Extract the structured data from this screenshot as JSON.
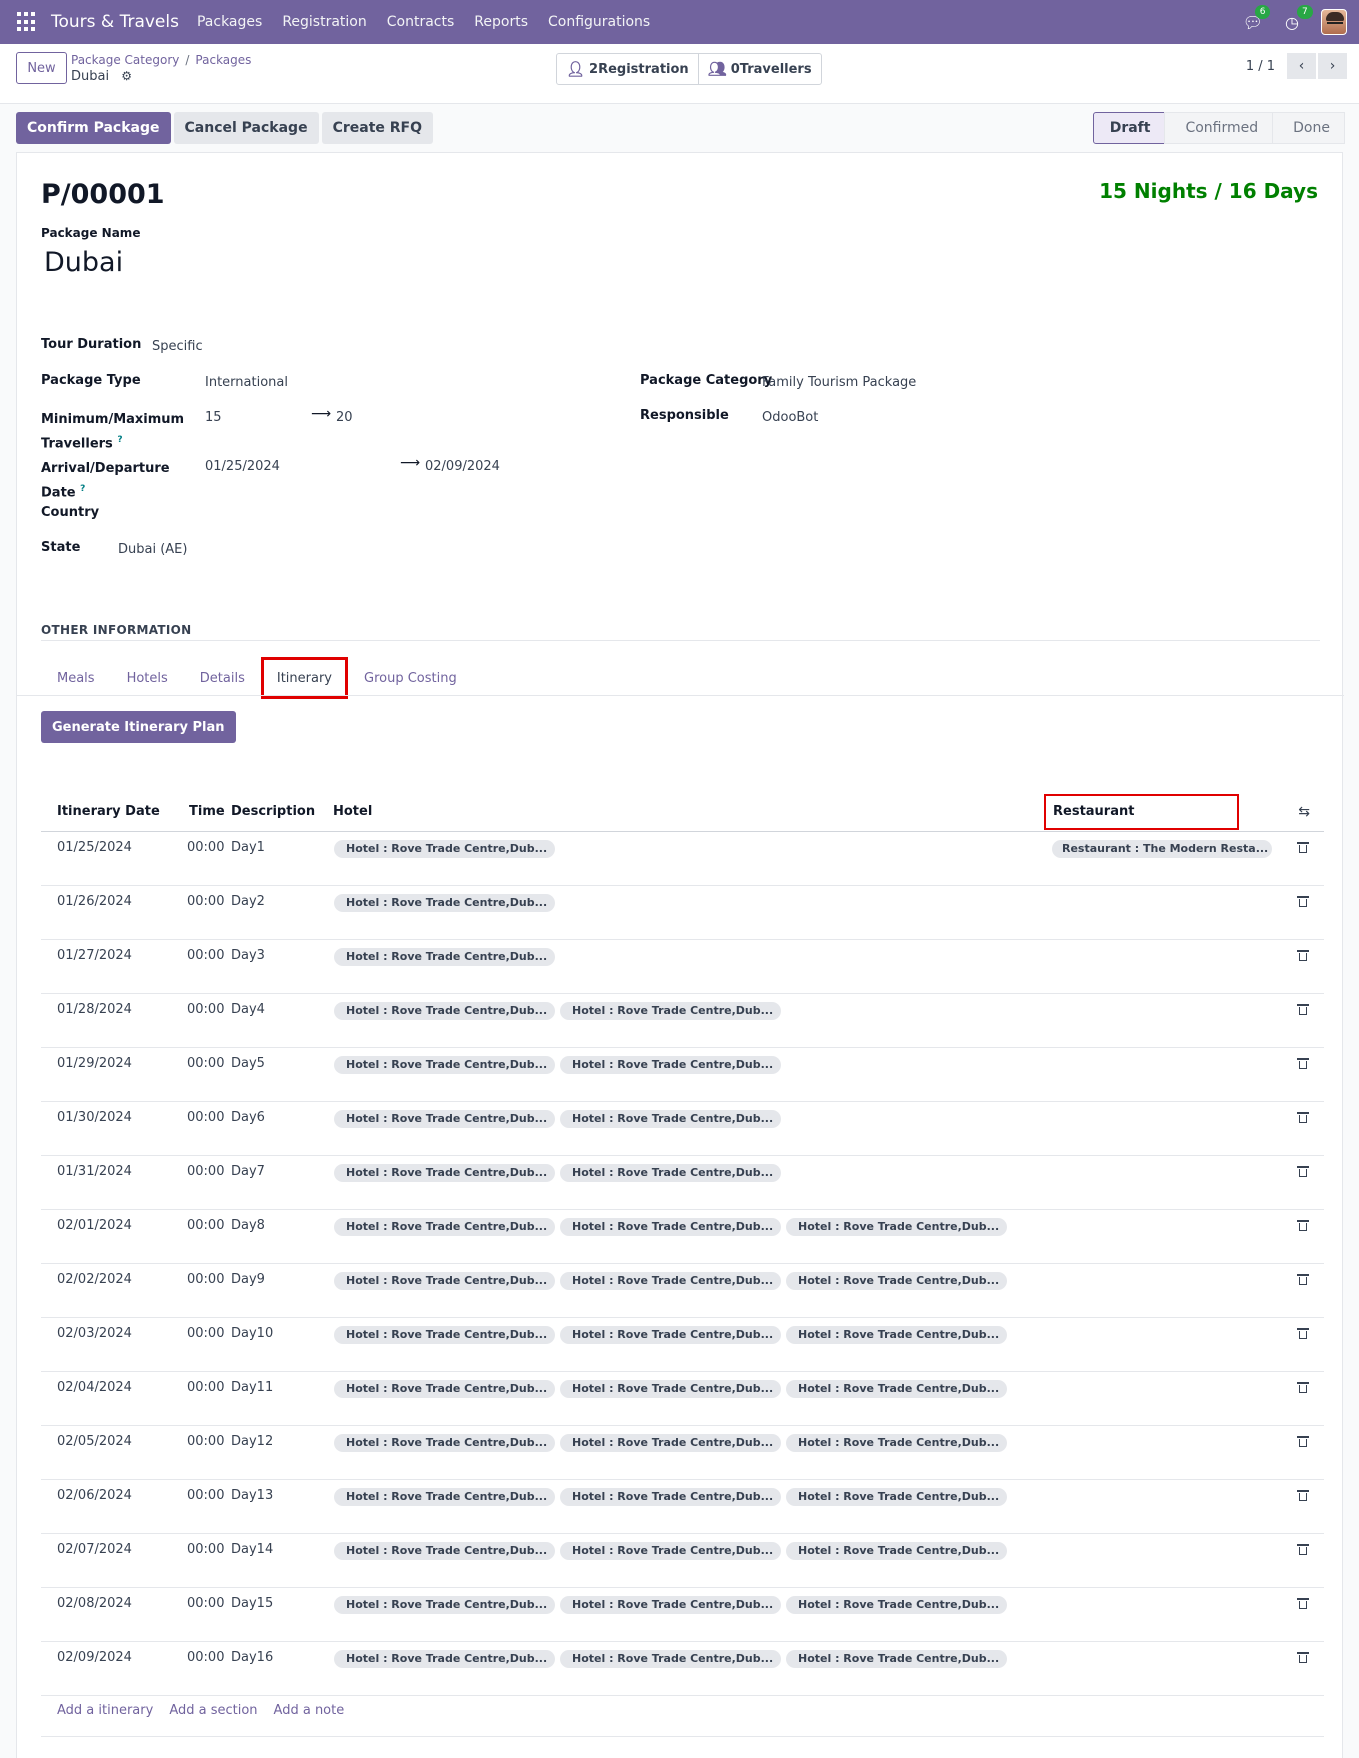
{
  "navbar": {
    "brand": "Tours & Travels",
    "menu": [
      "Packages",
      "Registration",
      "Contracts",
      "Reports",
      "Configurations"
    ],
    "messages_count": "6",
    "activities_count": "7"
  },
  "control": {
    "new_label": "New",
    "breadcrumb": [
      "Package Category",
      "Packages"
    ],
    "record_name": "Dubai",
    "smart_buttons": [
      {
        "count": "2",
        "label": "Registration"
      },
      {
        "count": "0",
        "label": "Travellers"
      }
    ],
    "pager": "1 / 1"
  },
  "actions": [
    "Confirm Package",
    "Cancel Package",
    "Create RFQ"
  ],
  "stages": [
    "Draft",
    "Confirmed",
    "Done"
  ],
  "form": {
    "reference": "P/00001",
    "nights_days": "15 Nights / 16 Days",
    "package_name_label": "Package Name",
    "package_name": "Dubai",
    "tour_duration_label": "Tour Duration",
    "tour_duration": "Specific",
    "package_type_label": "Package Type",
    "package_type": "International",
    "package_category_label": "Package Category",
    "package_category": "Family Tourism Package",
    "min_max_label_1": "Minimum/Maximum",
    "min_max_label_2": "Travellers",
    "min_travellers": "15",
    "max_travellers": "20",
    "responsible_label": "Responsible",
    "responsible": "OdooBot",
    "arrival_label_1": "Arrival/Departure",
    "arrival_label_2": "Date",
    "arrival_date": "01/25/2024",
    "departure_date": "02/09/2024",
    "country_label": "Country",
    "state_label": "State",
    "state": "Dubai (AE)",
    "qmark": "?"
  },
  "other_info": "OTHER INFORMATION",
  "tabs": [
    "Meals",
    "Hotels",
    "Details",
    "Itinerary",
    "Group Costing"
  ],
  "generate_button": "Generate Itinerary Plan",
  "table": {
    "headers": {
      "date": "Itinerary Date",
      "time": "Time",
      "description": "Description",
      "hotel": "Hotel",
      "restaurant": "Restaurant"
    },
    "hotel_tag": "Hotel : Rove Trade Centre,Dub...",
    "restaurant_tag": "Restaurant : The Modern Resta...",
    "rows": [
      {
        "date": "01/25/2024",
        "time": "00:00",
        "desc": "Day1",
        "hotels": 1,
        "restaurant": true
      },
      {
        "date": "01/26/2024",
        "time": "00:00",
        "desc": "Day2",
        "hotels": 1,
        "restaurant": false
      },
      {
        "date": "01/27/2024",
        "time": "00:00",
        "desc": "Day3",
        "hotels": 1,
        "restaurant": false
      },
      {
        "date": "01/28/2024",
        "time": "00:00",
        "desc": "Day4",
        "hotels": 2,
        "restaurant": false
      },
      {
        "date": "01/29/2024",
        "time": "00:00",
        "desc": "Day5",
        "hotels": 2,
        "restaurant": false
      },
      {
        "date": "01/30/2024",
        "time": "00:00",
        "desc": "Day6",
        "hotels": 2,
        "restaurant": false
      },
      {
        "date": "01/31/2024",
        "time": "00:00",
        "desc": "Day7",
        "hotels": 2,
        "restaurant": false
      },
      {
        "date": "02/01/2024",
        "time": "00:00",
        "desc": "Day8",
        "hotels": 3,
        "restaurant": false
      },
      {
        "date": "02/02/2024",
        "time": "00:00",
        "desc": "Day9",
        "hotels": 3,
        "restaurant": false
      },
      {
        "date": "02/03/2024",
        "time": "00:00",
        "desc": "Day10",
        "hotels": 3,
        "restaurant": false
      },
      {
        "date": "02/04/2024",
        "time": "00:00",
        "desc": "Day11",
        "hotels": 3,
        "restaurant": false
      },
      {
        "date": "02/05/2024",
        "time": "00:00",
        "desc": "Day12",
        "hotels": 3,
        "restaurant": false
      },
      {
        "date": "02/06/2024",
        "time": "00:00",
        "desc": "Day13",
        "hotels": 3,
        "restaurant": false
      },
      {
        "date": "02/07/2024",
        "time": "00:00",
        "desc": "Day14",
        "hotels": 3,
        "restaurant": false
      },
      {
        "date": "02/08/2024",
        "time": "00:00",
        "desc": "Day15",
        "hotels": 3,
        "restaurant": false
      },
      {
        "date": "02/09/2024",
        "time": "00:00",
        "desc": "Day16",
        "hotels": 3,
        "restaurant": false
      }
    ]
  },
  "add_links": [
    "Add a itinerary",
    "Add a section",
    "Add a note"
  ]
}
